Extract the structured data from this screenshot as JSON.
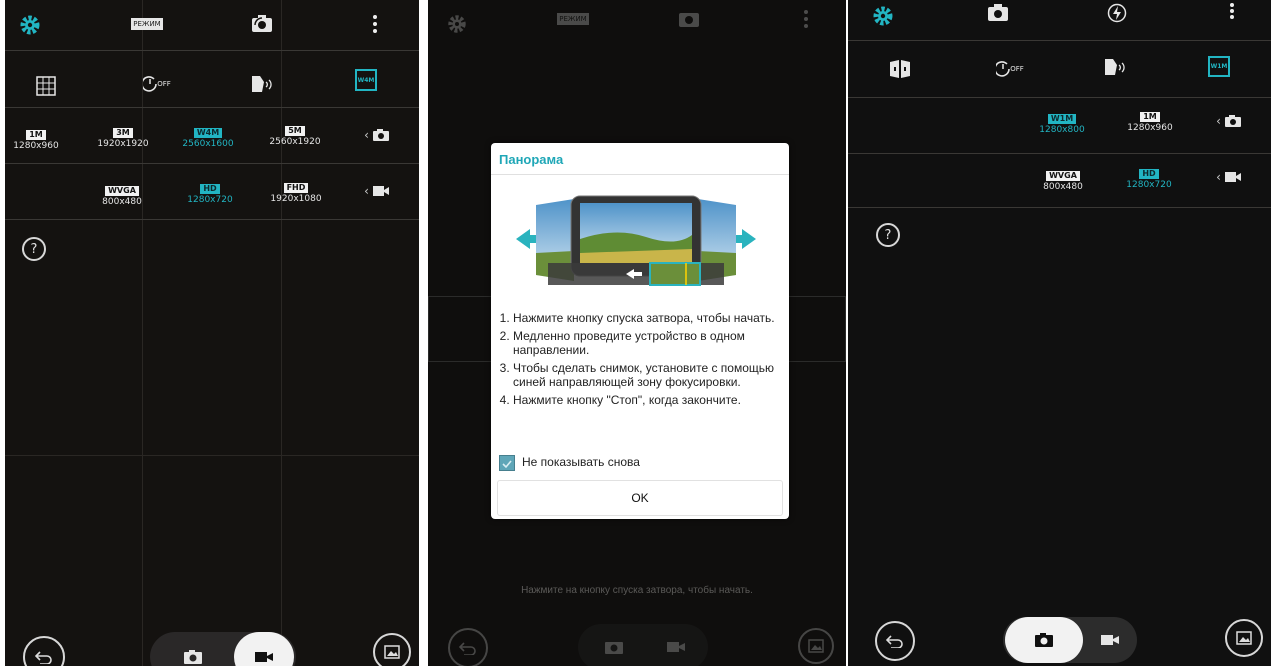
{
  "panel1": {
    "mode_label": "РЕЖИМ",
    "photo_sizes": [
      {
        "tag": "1M",
        "res": "1280x960",
        "selected": false
      },
      {
        "tag": "3M",
        "res": "1920x1920",
        "selected": false
      },
      {
        "tag": "W4M",
        "res": "2560x1600",
        "selected": true
      },
      {
        "tag": "5M",
        "res": "2560x1920",
        "selected": false
      }
    ],
    "video_sizes": [
      {
        "tag": "WVGA",
        "res": "800x480",
        "selected": false
      },
      {
        "tag": "HD",
        "res": "1280x720",
        "selected": true
      },
      {
        "tag": "FHD",
        "res": "1920x1080",
        "selected": false
      }
    ],
    "size_icon_label": "W4M",
    "timer_label": "OFF"
  },
  "panel2": {
    "mode_label": "РЕЖИМ",
    "dialog": {
      "title": "Панорама",
      "steps": [
        "Нажмите кнопку спуска затвора, чтобы начать.",
        "Медленно проведите устройство в одном направлении.",
        "Чтобы сделать снимок, установите с помощью синей направляющей зону фокусировки.",
        "Нажмите кнопку \"Стоп\", когда закончите."
      ],
      "checkbox_label": "Не показывать снова",
      "ok_label": "OK"
    },
    "hint": "Нажмите на кнопку спуска затвора, чтобы начать."
  },
  "panel3": {
    "photo_sizes": [
      {
        "tag": "W1M",
        "res": "1280x800",
        "selected": true
      },
      {
        "tag": "1M",
        "res": "1280x960",
        "selected": false
      }
    ],
    "video_sizes": [
      {
        "tag": "WVGA",
        "res": "800x480",
        "selected": false
      },
      {
        "tag": "HD",
        "res": "1280x720",
        "selected": true
      }
    ],
    "size_icon_label": "W1M",
    "timer_label": "OFF"
  },
  "colors": {
    "accent": "#22b5c3",
    "background": "#141210"
  }
}
